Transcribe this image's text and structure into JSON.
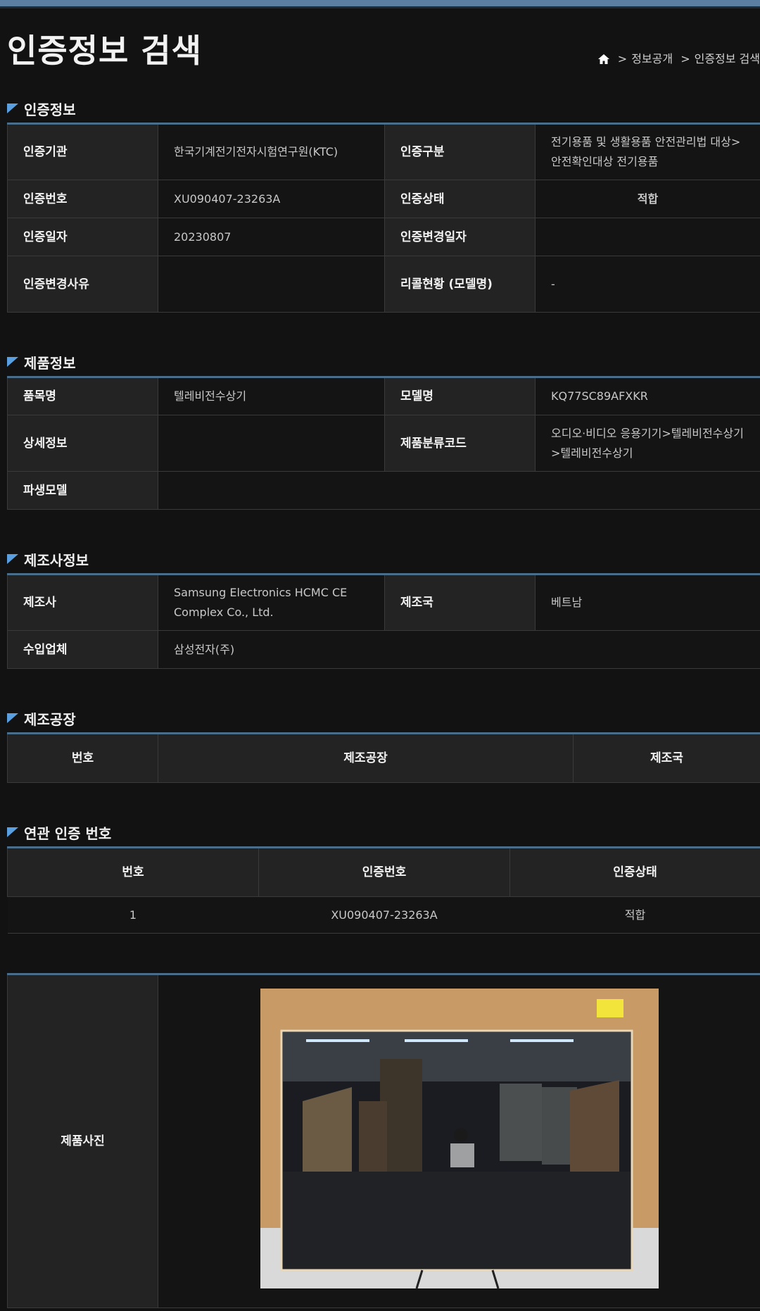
{
  "page": {
    "title": "인증정보 검색",
    "breadcrumb": [
      "정보공개",
      "인증정보 검색"
    ]
  },
  "cert_info": {
    "heading": "인증정보",
    "rows": [
      {
        "l1": "인증기관",
        "v1": "한국기계전기전자시험연구원(KTC)",
        "l2": "인증구분",
        "v2": "전기용품 및 생활용품 안전관리법 대상> 안전확인대상 전기용품"
      },
      {
        "l1": "인증번호",
        "v1": "XU090407-23263A",
        "l2": "인증상태",
        "v2": "적합"
      },
      {
        "l1": "인증일자",
        "v1": "20230807",
        "l2": "인증변경일자",
        "v2": ""
      },
      {
        "l1": "인증변경사유",
        "v1": "",
        "l2": "리콜현황 (모델명)",
        "v2": "-"
      }
    ]
  },
  "product_info": {
    "heading": "제품정보",
    "rows": [
      {
        "l1": "품목명",
        "v1": "텔레비전수상기",
        "l2": "모델명",
        "v2": "KQ77SC89AFXKR"
      },
      {
        "l1": "상세정보",
        "v1": "",
        "l2": "제품분류코드",
        "v2": "오디오·비디오 응용기기>텔레비전수상기 >텔레비전수상기"
      }
    ],
    "derived_label": "파생모델",
    "derived_value": ""
  },
  "maker_info": {
    "heading": "제조사정보",
    "maker_label": "제조사",
    "maker_value": "Samsung Electronics HCMC CE Complex Co., Ltd.",
    "country_label": "제조국",
    "country_value": "베트남",
    "importer_label": "수입업체",
    "importer_value": "삼성전자(주)"
  },
  "factory_info": {
    "heading": "제조공장",
    "columns": [
      "번호",
      "제조공장",
      "제조국"
    ]
  },
  "related": {
    "heading": "연관 인증 번호",
    "columns": [
      "번호",
      "인증번호",
      "인증상태"
    ],
    "rows": [
      {
        "no": "1",
        "cert_no": "XU090407-23263A",
        "status": "적합"
      }
    ]
  },
  "photo": {
    "label": "제품사진"
  },
  "colors": {
    "accent": "#4a6d8c",
    "status_ok": "#e08ff0",
    "label_bg": "#232323"
  }
}
